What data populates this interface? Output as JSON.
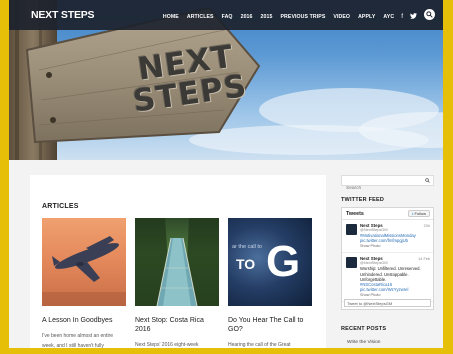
{
  "brand": "NEXT STEPS",
  "nav": {
    "items": [
      "HOME",
      "ARTICLES",
      "FAQ",
      "2016",
      "2015",
      "PREVIOUS TRIPS",
      "VIDEO",
      "APPLY",
      "AYC"
    ],
    "social": [
      "facebook-icon",
      "twitter-icon"
    ]
  },
  "hero": {
    "line1": "NEXT",
    "line2": "STEPS"
  },
  "articles": {
    "heading": "ARTICLES",
    "cards": [
      {
        "title": "A Lesson In Goodbyes",
        "excerpt": "I've been home almost an entire week, and I still haven't fully"
      },
      {
        "title": "Next Stop: Costa Rica 2016",
        "excerpt": "Next Steps' 2016 eight-week missions trip to Costa Rica is now"
      },
      {
        "title": "Do You Hear The Call to GO?",
        "excerpt": "Hearing the call of the Great Commission? Find out how to get",
        "thumb_text_small": "ar the call to",
        "thumb_text_to": "TO",
        "thumb_text_go": "G"
      }
    ]
  },
  "sidebar": {
    "search_placeholder": "Search",
    "twitter_heading": "TWITTER FEED",
    "twitter_box": {
      "title": "Tweets",
      "follow": "Follow",
      "tweets": [
        {
          "name": "Next Steps",
          "handle": "@NextStepsGM",
          "time": "20h",
          "text": "",
          "link": "#MotivationalMissionsMonday pic.twitter.com/fmfmpgjUb",
          "show": "Show Photo"
        },
        {
          "name": "Next Steps",
          "handle": "@NextStepsGM",
          "time": "14 Feb",
          "text": "Worship: Unfiltered. Unreserved. Unhindered. Unstoppable. Unforgettable.",
          "link": "#NSCostaRica16 pic.twitter.com/WzYyzwrel",
          "show": "Show Photo"
        }
      ],
      "tweet_input": "Tweet to @NextStepsGM"
    },
    "recent_heading": "RECENT POSTS",
    "recent_first": "Write the Vision"
  }
}
